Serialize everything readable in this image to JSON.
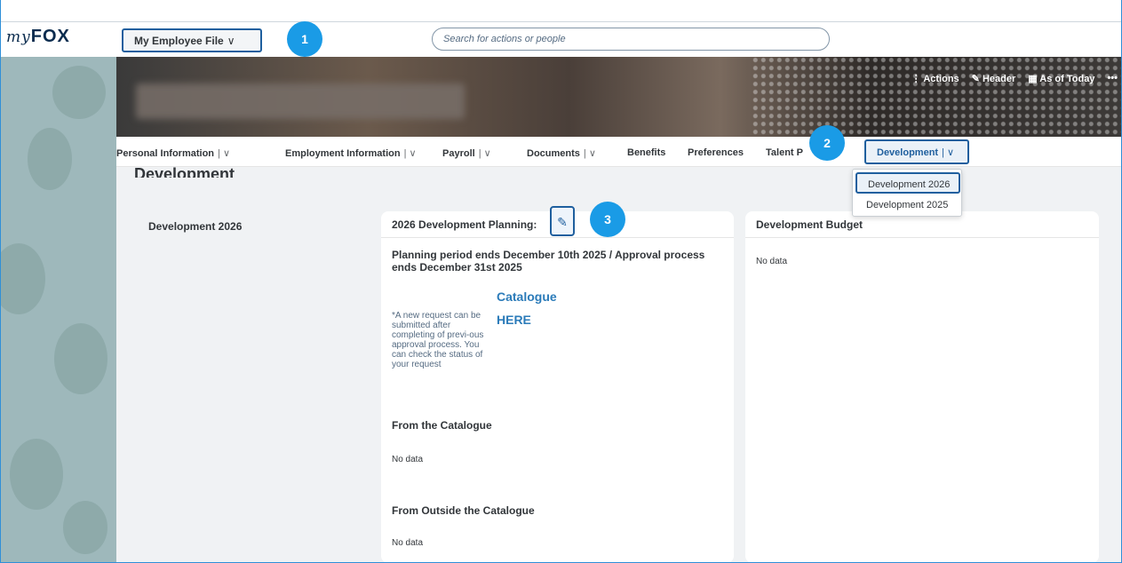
{
  "app": {
    "logo_my": "my",
    "logo_fox": "FOX"
  },
  "topbar": {
    "employee_file_label": "My Employee File",
    "search_placeholder": "Search for actions or people"
  },
  "header_actions": {
    "actions": "Actions",
    "header": "Header",
    "as_of": "As of Today",
    "more": "•••"
  },
  "nav": {
    "tabs": [
      {
        "label": "Personal Information",
        "sep": "| ∨"
      },
      {
        "label": "Employment Information",
        "sep": "| ∨"
      },
      {
        "label": "Payroll",
        "sep": "| ∨"
      },
      {
        "label": "Documents",
        "sep": "| ∨"
      },
      {
        "label": "Benefits",
        "sep": ""
      },
      {
        "label": "Preferences",
        "sep": ""
      },
      {
        "label": "Talent P",
        "sep": ""
      }
    ],
    "active_tab": {
      "label": "Development",
      "sep": "| ∨"
    },
    "dropdown": [
      "Development 2026",
      "Development 2025"
    ]
  },
  "content": {
    "section_title": "Development",
    "subsection": "Development 2026",
    "planning_card": {
      "title": "2026 Development Planning:",
      "period_text": "Planning period ends December 10th 2025 / Approval process ends December 31st 2025",
      "note": "*A new request can be submitted after completing of previ-ous approval process. You can check the status of your request",
      "catalogue_link": "Catalogue",
      "here_link": "HERE",
      "from_catalogue": "From the Catalogue",
      "from_catalogue_value": "No data",
      "from_outside": "From Outside the Catalogue",
      "from_outside_value": "No data"
    },
    "budget_card": {
      "title": "Development Budget",
      "value": "No data"
    }
  },
  "badges": [
    "1",
    "2",
    "3"
  ],
  "colors": {
    "accent": "#1f5f9e",
    "badge": "#1a9be6",
    "link": "#2b7bb9"
  }
}
